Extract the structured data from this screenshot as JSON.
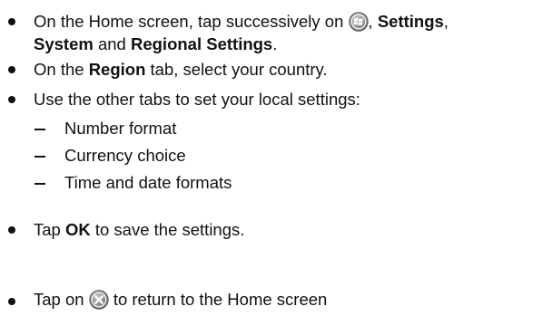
{
  "steps": [
    {
      "line1": {
        "t1": "On the Home screen, tap successively on",
        "t2": ",",
        "b1": "Settings",
        "t3": ","
      },
      "line2": {
        "b1": "System",
        "t1": "and",
        "b2": "Regional Settings",
        "t2": "."
      },
      "icon": "windows-start-icon"
    },
    {
      "t1": "On the",
      "b1": "Region",
      "t2": "tab, select your country."
    },
    {
      "t1": "Use the other tabs to set your local settings:",
      "subitems": [
        "Number format",
        "Currency choice",
        "Time and date formats"
      ]
    },
    {
      "t1": "Tap",
      "b1": "OK",
      "t2": "to save the settings."
    },
    {
      "t1": "Tap on",
      "t2": "to return to the Home screen",
      "icon": "close-x-icon"
    }
  ],
  "colors": {
    "text": "#111111",
    "icon_ring": "#6b6b6b",
    "icon_fill": "#8a8a8a"
  }
}
